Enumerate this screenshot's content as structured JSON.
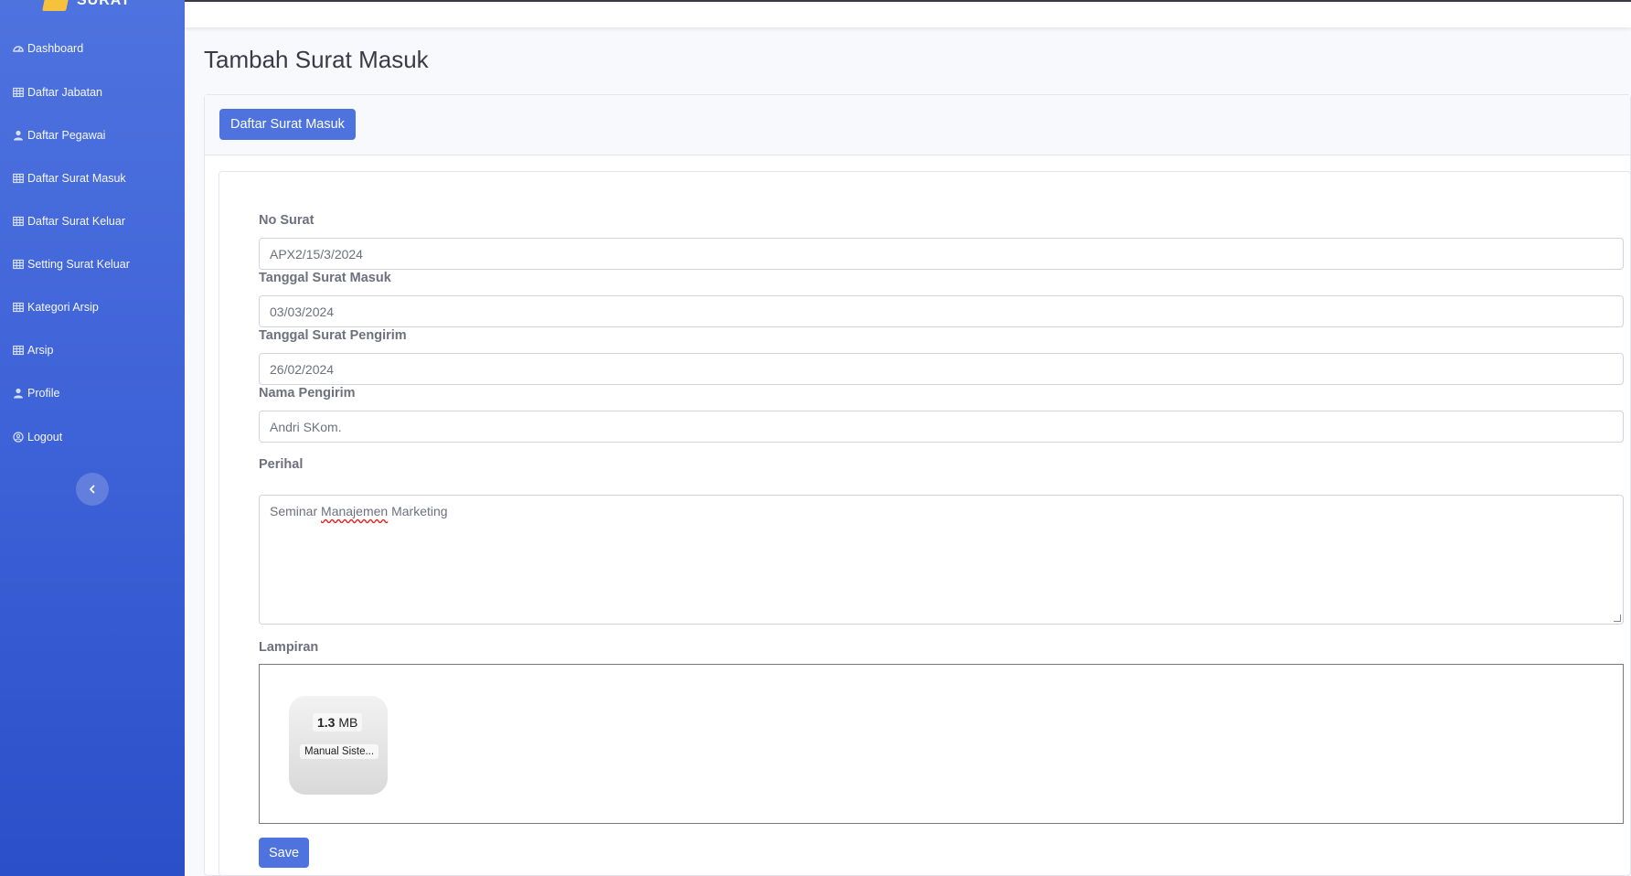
{
  "sidebar": {
    "brand": "SURAT",
    "items": [
      {
        "label": "Dashboard",
        "icon": "dashboard-icon"
      },
      {
        "label": "Daftar Jabatan",
        "icon": "table-icon"
      },
      {
        "label": "Daftar Pegawai",
        "icon": "user-icon"
      },
      {
        "label": "Daftar Surat Masuk",
        "icon": "table-icon"
      },
      {
        "label": "Daftar Surat Keluar",
        "icon": "table-icon"
      },
      {
        "label": "Setting Surat Keluar",
        "icon": "table-icon"
      },
      {
        "label": "Kategori Arsip",
        "icon": "table-icon"
      },
      {
        "label": "Arsip",
        "icon": "table-icon"
      },
      {
        "label": "Profile",
        "icon": "user-icon"
      },
      {
        "label": "Logout",
        "icon": "logout-icon"
      }
    ],
    "toggle_icon": "chevron-left-icon"
  },
  "page": {
    "title": "Tambah Surat Masuk",
    "list_button": "Daftar Surat Masuk"
  },
  "form": {
    "no_surat": {
      "label": "No Surat",
      "value": "APX2/15/3/2024"
    },
    "tanggal_masuk": {
      "label": "Tanggal Surat Masuk",
      "value": "03/03/2024"
    },
    "tanggal_pengirim": {
      "label": "Tanggal Surat Pengirim",
      "value": "26/02/2024"
    },
    "nama_pengirim": {
      "label": "Nama Pengirim",
      "value": "Andri SKom."
    },
    "perihal": {
      "label": "Perihal",
      "value_parts": [
        "Seminar ",
        "Manajemen",
        " Marketing"
      ]
    },
    "lampiran": {
      "label": "Lampiran",
      "file": {
        "size_value": "1.3",
        "size_unit": "MB",
        "name": "Manual Siste..."
      }
    },
    "save_button": "Save"
  },
  "colors": {
    "primary": "#4e73df",
    "sidebar_top": "#4e73df",
    "sidebar_bottom": "#2a4fc8",
    "text_muted": "#6e707e"
  }
}
